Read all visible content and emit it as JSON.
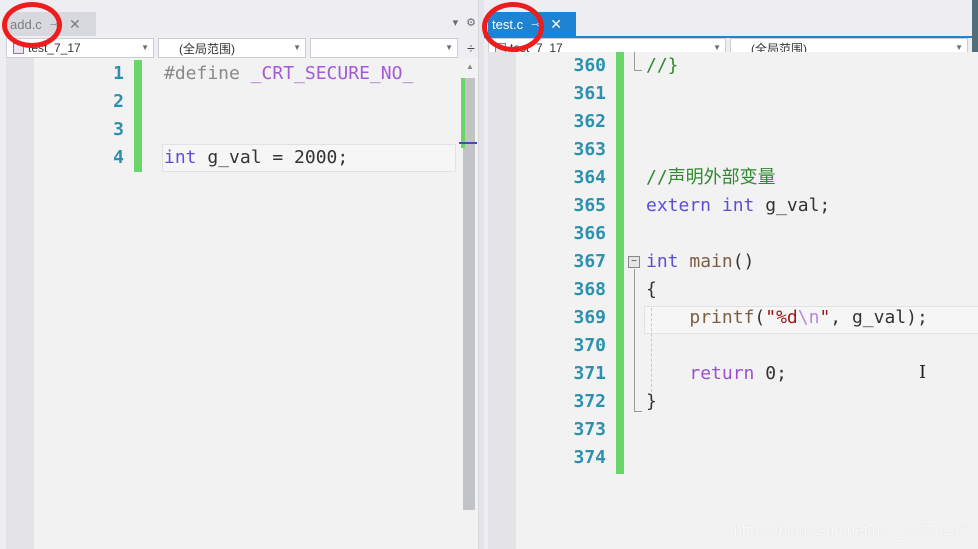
{
  "left_pane": {
    "tab": {
      "label": "add.c",
      "pin_icon": "pin-icon",
      "close_icon": "close-icon",
      "active": false
    },
    "tools": {
      "dropdown_icon": "▾",
      "settings_icon": "⚙"
    },
    "navbar": {
      "project": "test_7_17",
      "scope": "(全局范围)",
      "member": ""
    },
    "split_icon": "÷",
    "lines": [
      {
        "num": "1",
        "tokens": [
          {
            "t": "#define ",
            "c": "pp"
          },
          {
            "t": "_CRT_SECURE_NO_",
            "c": "macro"
          }
        ]
      },
      {
        "num": "2",
        "tokens": []
      },
      {
        "num": "3",
        "tokens": []
      },
      {
        "num": "4",
        "tokens": [
          {
            "t": "int",
            "c": "kw"
          },
          {
            "t": " g_val = 2000;",
            "c": "id"
          }
        ]
      }
    ]
  },
  "right_pane": {
    "tab": {
      "label": "test.c",
      "pin_icon": "pin-icon",
      "close_icon": "close-icon",
      "active": true
    },
    "navbar": {
      "project": "test_7_17",
      "scope": "(全局范围)"
    },
    "lines": [
      {
        "num": "360",
        "tokens": [
          {
            "t": "//}",
            "c": "cm"
          }
        ]
      },
      {
        "num": "361",
        "tokens": []
      },
      {
        "num": "362",
        "tokens": []
      },
      {
        "num": "363",
        "tokens": []
      },
      {
        "num": "364",
        "tokens": [
          {
            "t": "//声明外部变量",
            "c": "cm"
          }
        ]
      },
      {
        "num": "365",
        "tokens": [
          {
            "t": "extern",
            "c": "kw"
          },
          {
            "t": " ",
            "c": "id"
          },
          {
            "t": "int",
            "c": "kw"
          },
          {
            "t": " g_val;",
            "c": "id"
          }
        ]
      },
      {
        "num": "366",
        "tokens": []
      },
      {
        "num": "367",
        "tokens": [
          {
            "t": "int",
            "c": "kw"
          },
          {
            "t": " ",
            "c": "id"
          },
          {
            "t": "main",
            "c": "fn"
          },
          {
            "t": "()",
            "c": "id"
          }
        ]
      },
      {
        "num": "368",
        "tokens": [
          {
            "t": "{",
            "c": "id"
          }
        ]
      },
      {
        "num": "369",
        "tokens": [
          {
            "t": "    ",
            "c": "id"
          },
          {
            "t": "printf",
            "c": "fn"
          },
          {
            "t": "(",
            "c": "id"
          },
          {
            "t": "\"%d",
            "c": "str"
          },
          {
            "t": "\\n",
            "c": "esc"
          },
          {
            "t": "\"",
            "c": "str"
          },
          {
            "t": ", g_val);",
            "c": "id"
          }
        ]
      },
      {
        "num": "370",
        "tokens": []
      },
      {
        "num": "371",
        "tokens": [
          {
            "t": "    ",
            "c": "id"
          },
          {
            "t": "return",
            "c": "kw2"
          },
          {
            "t": " 0;",
            "c": "id"
          }
        ]
      },
      {
        "num": "372",
        "tokens": [
          {
            "t": "}",
            "c": "id"
          }
        ]
      },
      {
        "num": "373",
        "tokens": []
      },
      {
        "num": "374",
        "tokens": []
      }
    ]
  },
  "fold_icon": "−",
  "watermark": "https://blog.csdn.net/m0_53558236",
  "colors": {
    "active_tab": "#1f83d4",
    "change_bar": "#6ad66a",
    "line_number": "#2b91af",
    "annotation_circle": "#ee1c1c"
  }
}
